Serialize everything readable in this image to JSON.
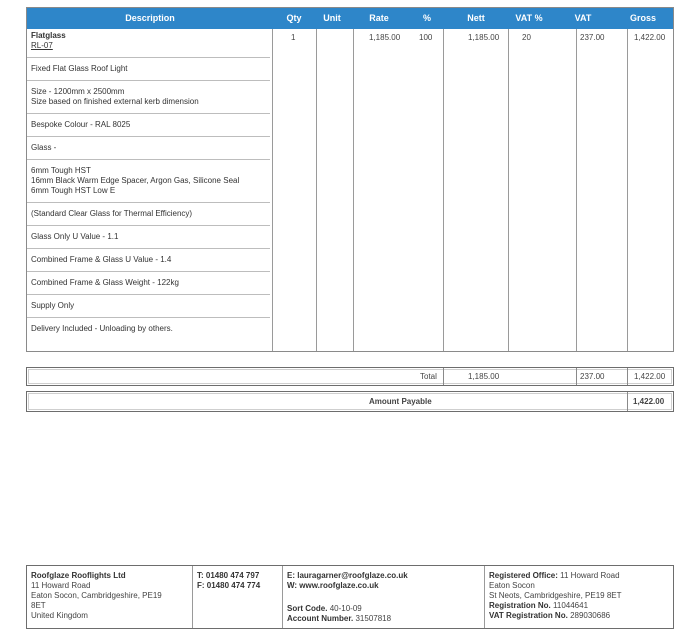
{
  "table": {
    "headers": {
      "description": "Description",
      "qty": "Qty",
      "unit": "Unit",
      "rate": "Rate",
      "pct": "%",
      "nett": "Nett",
      "vat_pct": "VAT %",
      "vat": "VAT",
      "gross": "Gross"
    },
    "header_color": "#2e86c9",
    "row": {
      "qty": "1",
      "unit": "",
      "rate": "1,185.00",
      "pct": "100",
      "nett": "1,185.00",
      "vat_pct": "20",
      "vat": "237.00",
      "gross": "1,422.00"
    },
    "description": {
      "title": "Flatglass",
      "code": "RL-07",
      "product": "Fixed Flat Glass Roof Light",
      "size_1": "Size - 1200mm x 2500mm",
      "size_2": "Size based on finished external kerb dimension",
      "colour": "Bespoke Colour - RAL 8025",
      "glass": "Glass -",
      "glass_1": "6mm Tough HST",
      "glass_2": "16mm Black Warm Edge Spacer, Argon Gas, Silicone Seal",
      "glass_3": "6mm Tough HST Low E",
      "standard": "(Standard Clear Glass for Thermal Efficiency)",
      "u_glass": "Glass Only U Value - 1.1",
      "u_combined": "Combined Frame & Glass U Value - 1.4",
      "weight": "Combined Frame & Glass Weight - 122kg",
      "supply": "Supply Only",
      "delivery": "Delivery Included - Unloading by others."
    }
  },
  "totals": {
    "label": "Total",
    "nett": "1,185.00",
    "vat": "237.00",
    "gross": "1,422.00"
  },
  "payable": {
    "label": "Amount Payable",
    "value": "1,422.00"
  },
  "footer": {
    "company": "Roofglaze Rooflights Ltd",
    "address_1": "11 Howard Road",
    "address_2": "Eaton Socon, Cambridgeshire, PE19",
    "address_3": "8ET",
    "address_4": "United Kingdom",
    "tel": "T: 01480 474 797",
    "fax": "F: 01480 474 774",
    "email": "E: lauragarner@roofglaze.co.uk",
    "web": "W: www.roofglaze.co.uk",
    "sort_label": "Sort Code.",
    "sort_value": "40-10-09",
    "account_label": "Account Number.",
    "account_value": "31507818",
    "reg_office_label": "Registered Office:",
    "reg_office_value": "11 Howard Road",
    "reg_office_2": "Eaton Socon",
    "reg_office_3": "St Neots, Cambridgeshire, PE19 8ET",
    "reg_no_label": "Registration No.",
    "reg_no_value": "11044641",
    "vat_reg_label": "VAT Registration No.",
    "vat_reg_value": "289030686"
  }
}
